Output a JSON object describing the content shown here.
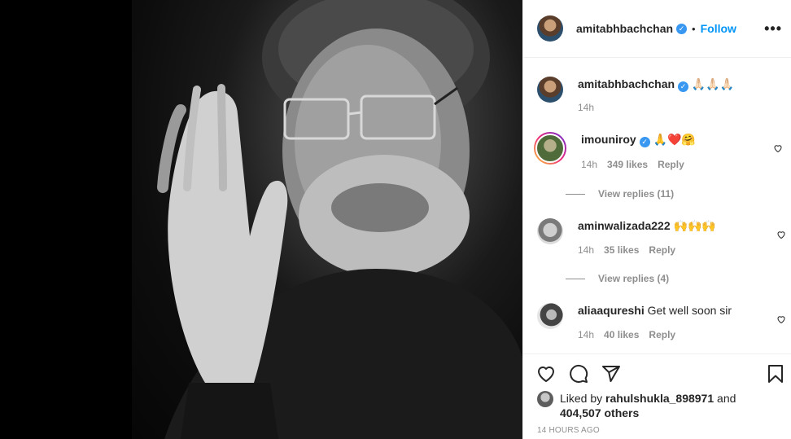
{
  "header": {
    "username": "amitabhbachchan",
    "verified_mark": "✓",
    "separator": "•",
    "follow_label": "Follow",
    "more_label": "•••"
  },
  "caption": {
    "username": "amitabhbachchan",
    "text": "🙏🏻🙏🏻🙏🏻",
    "time": "14h"
  },
  "comments": [
    {
      "username": "imouniroy",
      "text": "🙏❤️🤗",
      "time": "14h",
      "likes": "349 likes",
      "reply_label": "Reply",
      "view_replies": "View replies (11)"
    },
    {
      "username": "aminwalizada222",
      "text": "🙌🙌🙌",
      "time": "14h",
      "likes": "35 likes",
      "reply_label": "Reply",
      "view_replies": "View replies (4)"
    },
    {
      "username": "aliaaqureshi",
      "text": "Get well soon sir",
      "time": "14h",
      "likes": "40 likes",
      "reply_label": "Reply"
    }
  ],
  "actions": {
    "liked_by_prefix": "Liked by",
    "liked_by_user": "rahulshukla_898971",
    "and_label": "and",
    "others": "404,507 others",
    "timestamp": "14 HOURS AGO"
  },
  "icons": {
    "like": "heart-icon",
    "comment": "comment-icon",
    "share": "share-icon",
    "save": "bookmark-icon",
    "more": "more-options-icon"
  },
  "colors": {
    "accent": "#0095f6",
    "verified": "#3897f0",
    "muted": "#8e8e8e",
    "text": "#262626"
  }
}
